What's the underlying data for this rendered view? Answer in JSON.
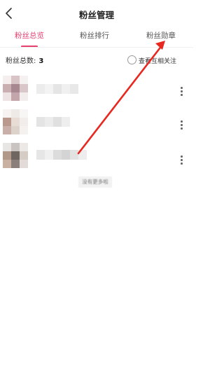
{
  "header": {
    "title": "粉丝管理",
    "back_icon": "chevron-left-icon"
  },
  "tabs": [
    {
      "label": "粉丝总览",
      "active": true
    },
    {
      "label": "粉丝排行",
      "active": false
    },
    {
      "label": "粉丝勋章",
      "active": false
    }
  ],
  "summary": {
    "label": "粉丝总数:",
    "count": "3"
  },
  "filter": {
    "label": "查看互相关注",
    "checked": false
  },
  "fans": [
    {
      "avatar": "blurred-avatar",
      "name": "(blurred)"
    },
    {
      "avatar": "blurred-avatar",
      "name": "(blurred)"
    },
    {
      "avatar": "blurred-avatar",
      "name": "(blurred)"
    }
  ],
  "footer": {
    "no_more_text": "没有更多啦"
  },
  "colors": {
    "accent": "#e6406e",
    "annotation_arrow": "#e8271f"
  }
}
